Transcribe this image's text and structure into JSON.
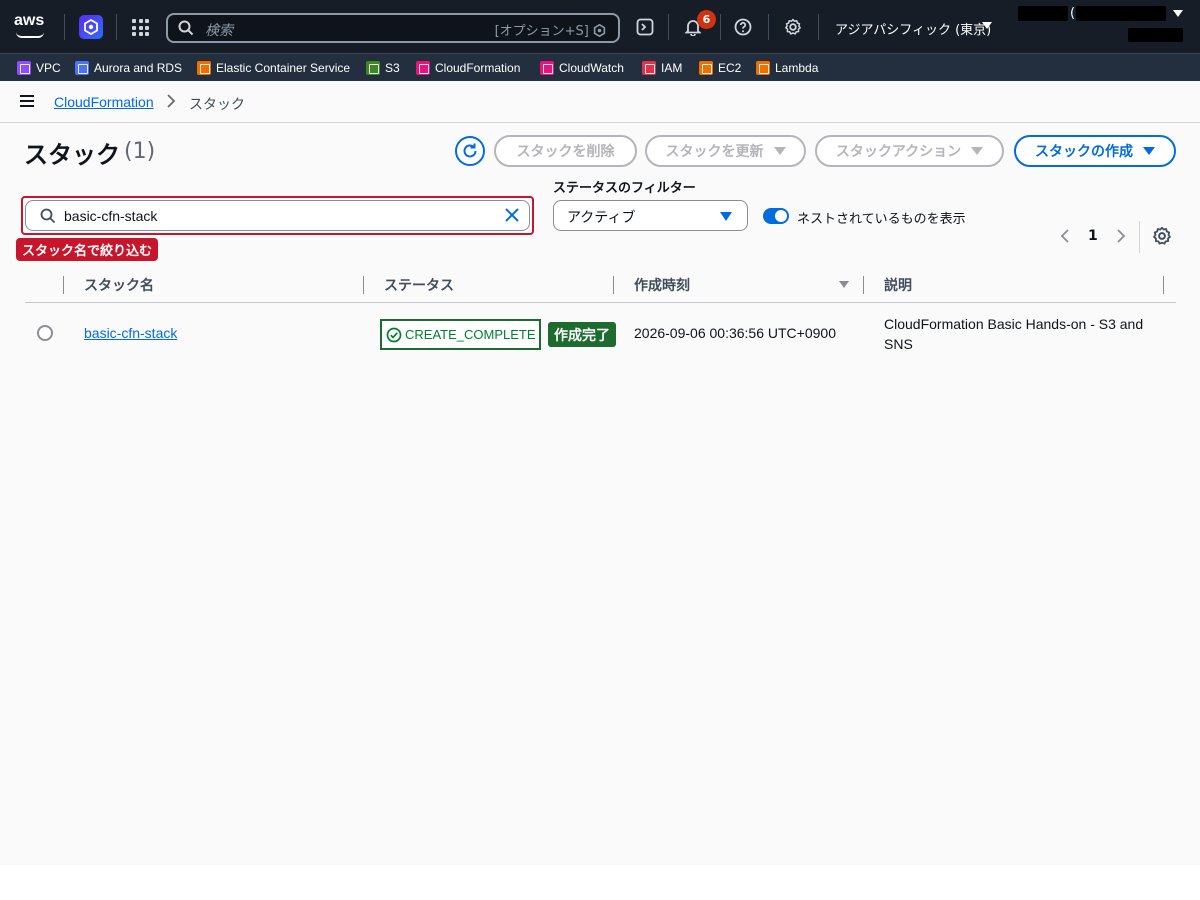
{
  "topnav": {
    "logo": "aws",
    "search_placeholder": "検索",
    "search_shortcut": "[オプション+S]",
    "notifications_count": "6",
    "region": "アジアパシフィック (東京)",
    "account_paren": "("
  },
  "favorites": [
    {
      "label": "VPC",
      "color": "#8c4fff"
    },
    {
      "label": "Aurora and RDS",
      "color": "#4d72f3"
    },
    {
      "label": "Elastic Container Service",
      "color": "#ed7100"
    },
    {
      "label": "S3",
      "color": "#3f8624"
    },
    {
      "label": "CloudFormation",
      "color": "#e7157b"
    },
    {
      "label": "CloudWatch",
      "color": "#e7157b"
    },
    {
      "label": "IAM",
      "color": "#dd344c"
    },
    {
      "label": "EC2",
      "color": "#ed7100"
    },
    {
      "label": "Lambda",
      "color": "#ed7100"
    }
  ],
  "breadcrumb": {
    "parent": "CloudFormation",
    "current": "スタック"
  },
  "header": {
    "title": "スタック",
    "count": "(1)"
  },
  "actions": {
    "delete": "スタックを削除",
    "update": "スタックを更新",
    "stack_actions": "スタックアクション",
    "create": "スタックの作成"
  },
  "filter": {
    "value": "basic-cfn-stack",
    "annotation": "スタック名で絞り込む",
    "status_label": "ステータスのフィルター",
    "status_value": "アクティブ",
    "nested_label": "ネストされているものを表示",
    "nested_on": true
  },
  "pagination": {
    "page": "1"
  },
  "table": {
    "columns": [
      "スタック名",
      "ステータス",
      "作成時刻",
      "説明"
    ],
    "rows": [
      {
        "name": "basic-cfn-stack",
        "status": "CREATE_COMPLETE",
        "status_annotation": "作成完了",
        "created": "2026-09-06 00:36:56 UTC+0900",
        "description": "CloudFormation Basic Hands-on - S3 and SNS"
      }
    ]
  },
  "colors": {
    "nav_bg": "#161d26",
    "accent": "#006ce0",
    "annotation_red": "#c7162b",
    "success_green": "#00802f"
  }
}
